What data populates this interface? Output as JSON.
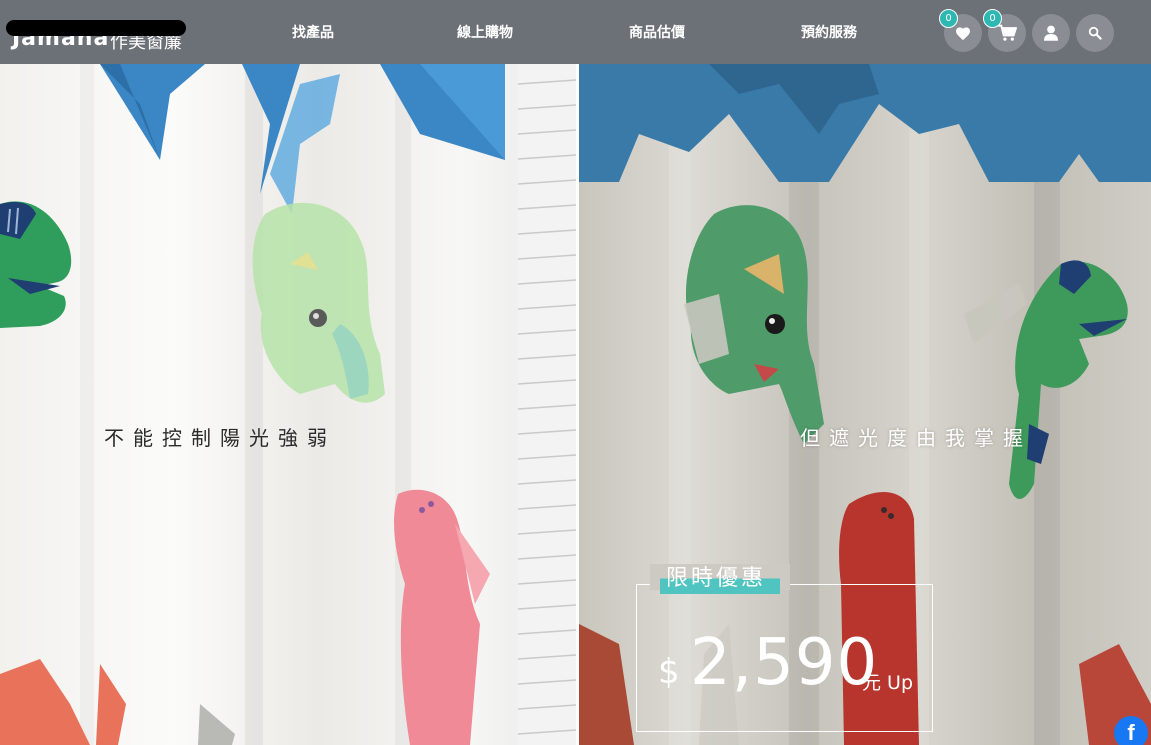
{
  "header": {
    "logo": {
      "latin": "Jamana",
      "cjk": "作美窗簾"
    },
    "nav": [
      {
        "label": "找產品"
      },
      {
        "label": "線上購物"
      },
      {
        "label": "商品估價"
      },
      {
        "label": "預約服務"
      }
    ],
    "wishlist": {
      "icon": "heart-icon",
      "count": "0"
    },
    "cart": {
      "icon": "cart-icon",
      "count": "0"
    },
    "account": {
      "icon": "user-icon"
    },
    "search": {
      "icon": "search-icon"
    }
  },
  "banner": {
    "left_slogan": "不能控制陽光強弱",
    "right_slogan": "但遮光度由我掌握",
    "promo": {
      "title": "限時優惠",
      "currency": "$",
      "price": "2,590",
      "unit": "元 Up"
    }
  },
  "social": {
    "facebook_icon": "facebook-icon",
    "label": "f"
  },
  "colors": {
    "header_bg": "#6c7077",
    "accent_teal": "#4fc4c0",
    "badge": "#2eb8b3",
    "dino_green": "#2f9e5c",
    "dino_blue": "#3b86c4",
    "dino_red": "#b8352e",
    "dino_coral": "#e8735a",
    "facebook": "#1877f2"
  }
}
